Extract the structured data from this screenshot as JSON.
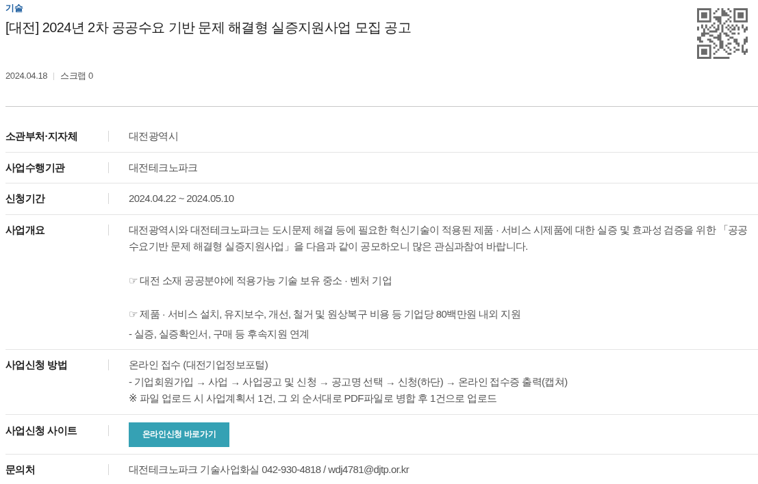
{
  "category": "기술",
  "title": "[대전] 2024년 2차 공공수요 기반 문제 해결형 실증지원사업 모집 공고",
  "meta": {
    "date": "2024.04.18",
    "scrap": "스크랩 0"
  },
  "details": [
    {
      "kind": "text",
      "label": "소관부처·지자체",
      "paragraphs": [
        [
          "대전광역시"
        ]
      ]
    },
    {
      "kind": "text",
      "label": "사업수행기관",
      "paragraphs": [
        [
          "대전테크노파크"
        ]
      ]
    },
    {
      "kind": "text",
      "label": "신청기간",
      "paragraphs": [
        [
          "2024.04.22 ~ 2024.05.10"
        ]
      ]
    },
    {
      "kind": "text",
      "label": "사업개요",
      "paragraphs": [
        [
          "대전광역시와 대전테크노파크는 도시문제 해결 등에 필요한 혁신기술이 적용된 제품 · 서비스 시제품에 대한 실증 및 효과성 검증을 위한 「공공수요기반 문제 해결형 실증지원사업」을 다음과 같이 공모하오니 많은 관심과참여 바랍니다."
        ],
        [
          "☞ 대전 소재 공공분야에 적용가능 기술 보유 중소 · 벤처 기업"
        ],
        [
          "☞ 제품 · 서비스 설치, 유지보수, 개선, 철거 및 원상복구 비용 등 기업당 80백만원 내외 지원",
          "- 실증, 실증확인서, 구매 등 후속지원 연계"
        ]
      ]
    },
    {
      "kind": "text",
      "label": "사업신청 방법",
      "paragraphs": [
        [
          "온라인 접수 (대전기업정보포털)",
          "- 기업회원가입 → 사업 → 사업공고 및 신청 → 공고명 선택 → 신청(하단) → 온라인 접수증 출력(캡쳐)",
          "※ 파일 업로드 시 사업계획서 1건, 그 외 순서대로 PDF파일로 병합 후 1건으로 업로드"
        ]
      ]
    },
    {
      "kind": "button",
      "label": "사업신청 사이트",
      "button": "온라인신청 바로가기"
    },
    {
      "kind": "text",
      "label": "문의처",
      "paragraphs": [
        [
          "대전테크노파크 기술사업화실 042-930-4818 / wdj4781@djtp.or.kr"
        ]
      ]
    }
  ]
}
